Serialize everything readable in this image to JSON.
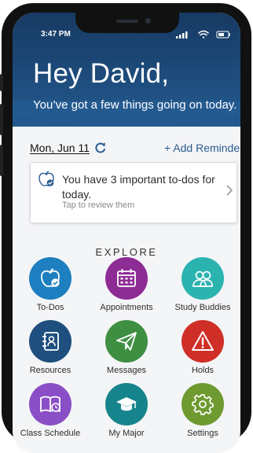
{
  "status_bar": {
    "time": "3:47 PM"
  },
  "header": {
    "greeting": "Hey David,",
    "subtitle": "You’ve got a few things going on today."
  },
  "date_row": {
    "date": "Mon, Jun 11",
    "add_reminder_label": "+ Add Reminder"
  },
  "todo_card": {
    "title": "You have 3 important to-dos for today.",
    "subtitle": "Tap to review them"
  },
  "explore": {
    "heading": "EXPLORE",
    "tiles": [
      {
        "label": "To-Dos",
        "color": "#1d7fbf",
        "icon": "apple-check-icon"
      },
      {
        "label": "Appointments",
        "color": "#8e2c96",
        "icon": "calendar-icon"
      },
      {
        "label": "Study Buddies",
        "color": "#2bb3b0",
        "icon": "people-icon"
      },
      {
        "label": "Resources",
        "color": "#1e4f7f",
        "icon": "address-book-icon"
      },
      {
        "label": "Messages",
        "color": "#3f8f43",
        "icon": "paper-plane-icon"
      },
      {
        "label": "Holds",
        "color": "#cf2f26",
        "icon": "warning-icon"
      },
      {
        "label": "Class Schedule",
        "color": "#8a4fc6",
        "icon": "book-icon"
      },
      {
        "label": "My Major",
        "color": "#16848c",
        "icon": "graduation-cap-icon"
      },
      {
        "label": "Settings",
        "color": "#6e9a2f",
        "icon": "gear-icon"
      }
    ]
  },
  "colors": {
    "header_bg": "#1d4b7b",
    "accent": "#2b5d90"
  }
}
